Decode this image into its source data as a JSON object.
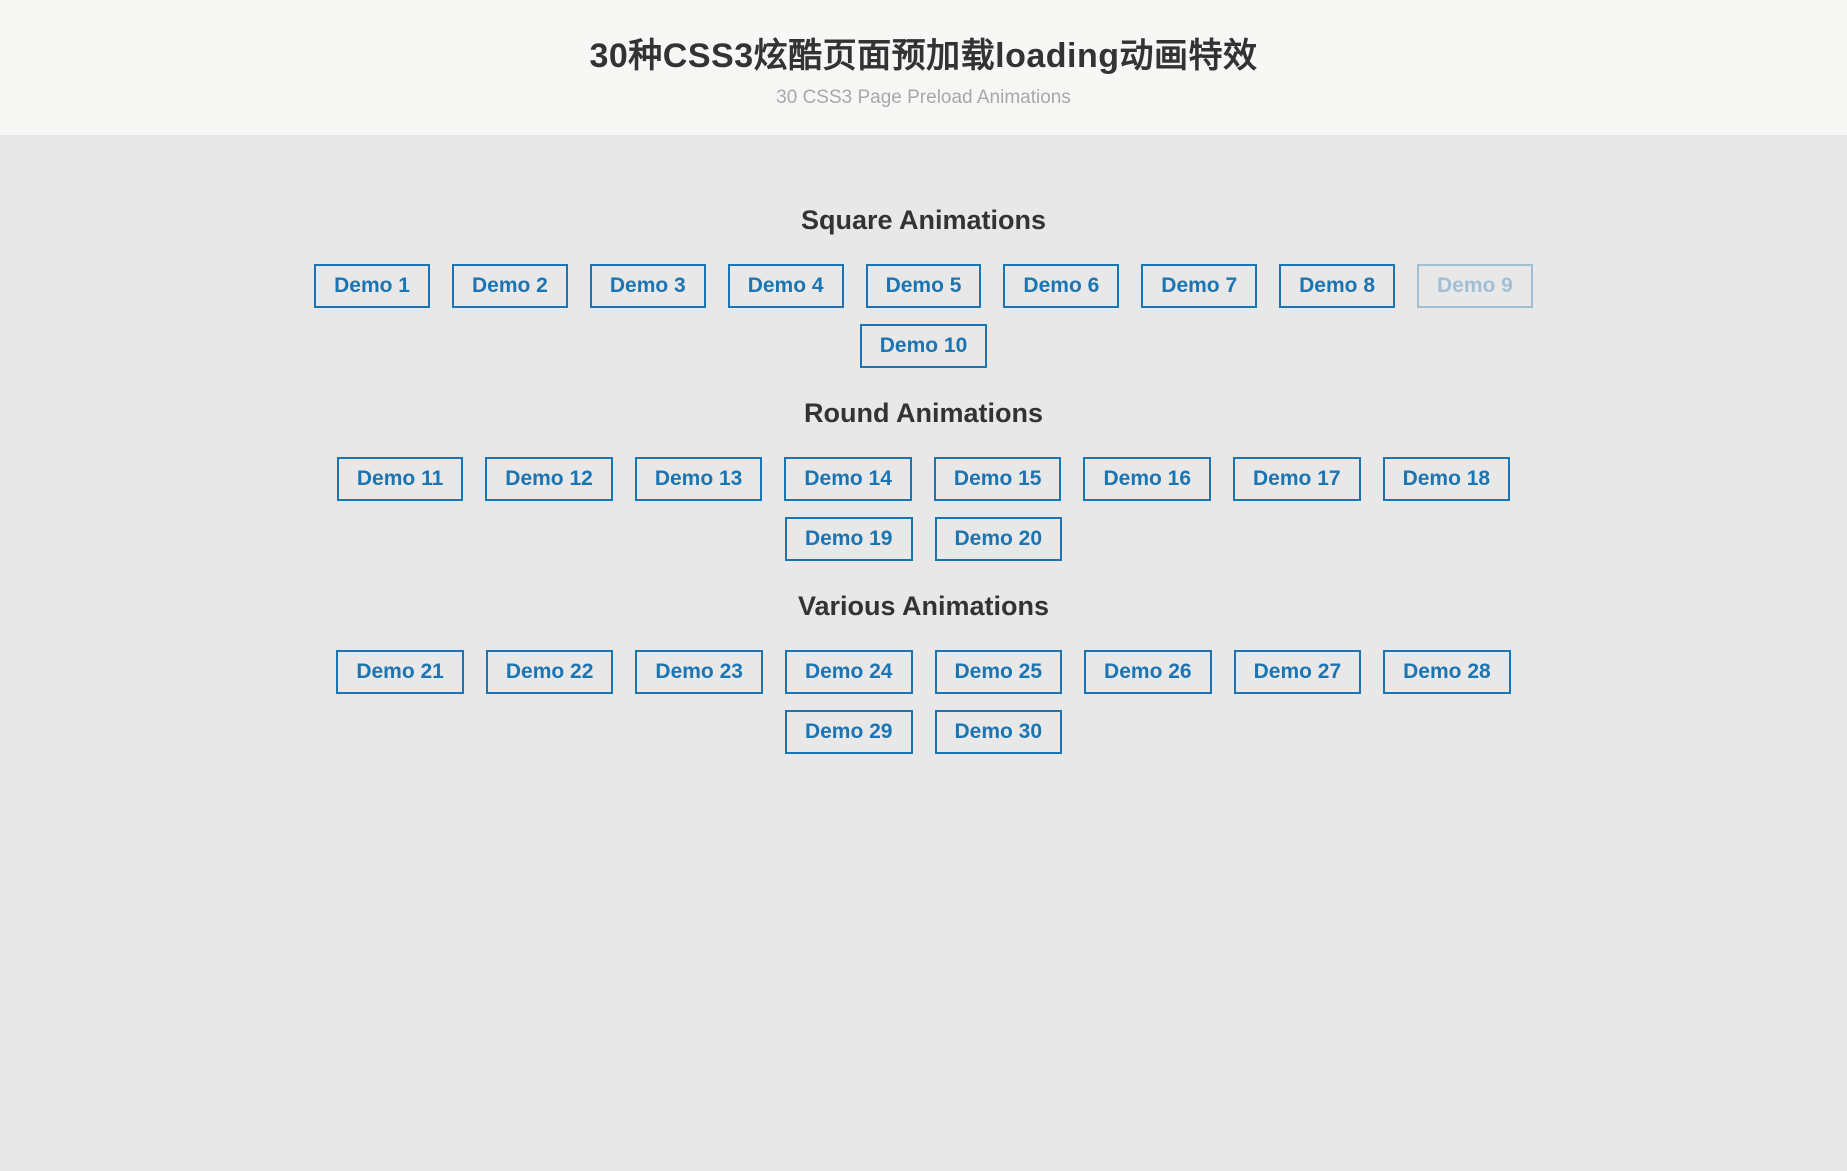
{
  "header": {
    "title": "30种CSS3炫酷页面预加载loading动画特效",
    "subtitle": "30 CSS3 Page Preload Animations"
  },
  "sections": [
    {
      "heading": "Square Animations",
      "demos": [
        "Demo 1",
        "Demo 2",
        "Demo 3",
        "Demo 4",
        "Demo 5",
        "Demo 6",
        "Demo 7",
        "Demo 8",
        "Demo 9",
        "Demo 10"
      ],
      "hovered_index": 8
    },
    {
      "heading": "Round Animations",
      "demos": [
        "Demo 11",
        "Demo 12",
        "Demo 13",
        "Demo 14",
        "Demo 15",
        "Demo 16",
        "Demo 17",
        "Demo 18",
        "Demo 19",
        "Demo 20"
      ],
      "hovered_index": -1
    },
    {
      "heading": "Various Animations",
      "demos": [
        "Demo 21",
        "Demo 22",
        "Demo 23",
        "Demo 24",
        "Demo 25",
        "Demo 26",
        "Demo 27",
        "Demo 28",
        "Demo 29",
        "Demo 30"
      ],
      "hovered_index": -1
    }
  ]
}
